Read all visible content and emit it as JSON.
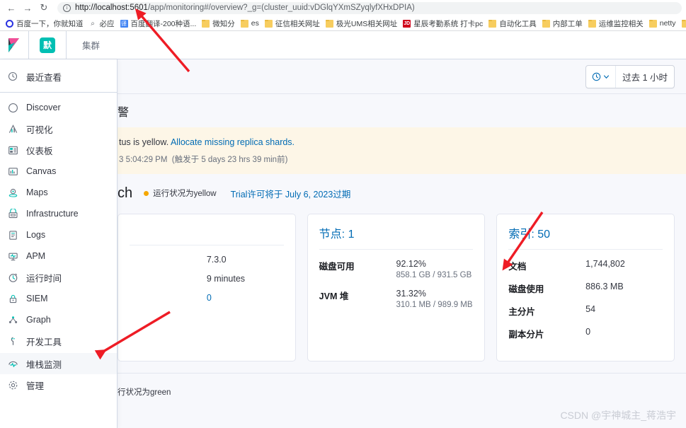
{
  "browser": {
    "back_icon": "back-arrow-icon",
    "forward_icon": "forward-arrow-icon",
    "reload_icon": "reload-icon",
    "url_host": "http://localhost:5601",
    "url_rest": "/app/monitoring#/overview?_g=(cluster_uuid:vDGlqYXmSZyqlyfXHxDPIA)",
    "bookmarks": [
      {
        "label": "百度一下，你就知道",
        "icon": "baidu-icon"
      },
      {
        "label": "必应",
        "icon": "bing-search-icon"
      },
      {
        "label": "百度翻译-200种语...",
        "icon": "translate-icon"
      },
      {
        "label": "微知分",
        "icon": "folder-icon"
      },
      {
        "label": "es",
        "icon": "folder-icon"
      },
      {
        "label": "征信相关网址",
        "icon": "folder-icon"
      },
      {
        "label": "极光UMS相关网址",
        "icon": "folder-icon"
      },
      {
        "label": "星辰考勤系统 打卡pc",
        "icon": "jd-icon"
      },
      {
        "label": "自动化工具",
        "icon": "folder-icon"
      },
      {
        "label": "内部工单",
        "icon": "folder-icon"
      },
      {
        "label": "运维监控相关",
        "icon": "folder-icon"
      },
      {
        "label": "netty",
        "icon": "folder-icon"
      },
      {
        "label": "",
        "icon": "folder-icon"
      }
    ]
  },
  "kibana_header": {
    "logo_icon": "kibana-logo-icon",
    "space_badge": "默",
    "breadcrumb": "集群"
  },
  "sidebar": {
    "recent": {
      "label": "最近查看",
      "icon": "clock-icon"
    },
    "items": [
      {
        "label": "Discover",
        "icon": "discover-compass-icon",
        "selected": false
      },
      {
        "label": "可视化",
        "icon": "visualize-icon",
        "selected": false
      },
      {
        "label": "仪表板",
        "icon": "dashboard-icon",
        "selected": false
      },
      {
        "label": "Canvas",
        "icon": "canvas-icon",
        "selected": false
      },
      {
        "label": "Maps",
        "icon": "maps-icon",
        "selected": false
      },
      {
        "label": "Infrastructure",
        "icon": "infrastructure-icon",
        "selected": false
      },
      {
        "label": "Logs",
        "icon": "logs-icon",
        "selected": false
      },
      {
        "label": "APM",
        "icon": "apm-icon",
        "selected": false
      },
      {
        "label": "运行时间",
        "icon": "uptime-icon",
        "selected": false
      },
      {
        "label": "SIEM",
        "icon": "siem-lock-icon",
        "selected": false
      },
      {
        "label": "Graph",
        "icon": "graph-icon",
        "selected": false
      },
      {
        "label": "开发工具",
        "icon": "dev-tools-wrench-icon",
        "selected": false
      },
      {
        "label": "堆栈监测",
        "icon": "stack-monitoring-icon",
        "selected": true
      },
      {
        "label": "管理",
        "icon": "management-gear-icon",
        "selected": false
      }
    ]
  },
  "timebar": {
    "calendar_icon": "calendar-clock-icon",
    "chevron_icon": "chevron-down-icon",
    "range_label": "过去 1 小时"
  },
  "alerts": {
    "heading": "警",
    "message_prefix": "tus is yellow. ",
    "message_link": "Allocate missing replica shards.",
    "timestamp": "3 5:04:29 PM",
    "triggered": "(触发于 5 days 23 hrs 39 min前)"
  },
  "cluster": {
    "name_fragment": "ch",
    "health_label": "运行状况为yellow",
    "health_dot_color": "#f5a700",
    "license_text": "Trial许可将于 July 6, 2023过期"
  },
  "panels": [
    {
      "title": "",
      "rows": [
        {
          "key": "",
          "value": "7.3.0",
          "sub": "",
          "link": false
        },
        {
          "key": "",
          "value": "9 minutes",
          "sub": "",
          "link": false
        },
        {
          "key": "",
          "value": "0",
          "sub": "",
          "link": true
        }
      ]
    },
    {
      "title": "节点: 1",
      "rows": [
        {
          "key": "磁盘可用",
          "value": "92.12%",
          "sub": "858.1 GB / 931.5 GB",
          "link": false
        },
        {
          "key": "JVM 堆",
          "value": "31.32%",
          "sub": "310.1 MB / 989.9 MB",
          "link": false
        }
      ]
    },
    {
      "title": "索引: 50",
      "rows": [
        {
          "key": "文档",
          "value": "1,744,802",
          "sub": "",
          "link": false
        },
        {
          "key": "磁盘使用",
          "value": "886.3 MB",
          "sub": "",
          "link": false
        },
        {
          "key": "主分片",
          "value": "54",
          "sub": "",
          "link": false
        },
        {
          "key": "副本分片",
          "value": "0",
          "sub": "",
          "link": false
        }
      ]
    }
  ],
  "bottom": {
    "health_label": "行状况为green",
    "health_dot_color": "#017d73"
  },
  "watermark": "CSDN @宇神城主_蒋浩宇",
  "annotations": {
    "arrow_color": "#ee1c25",
    "arrow_count": 3
  }
}
